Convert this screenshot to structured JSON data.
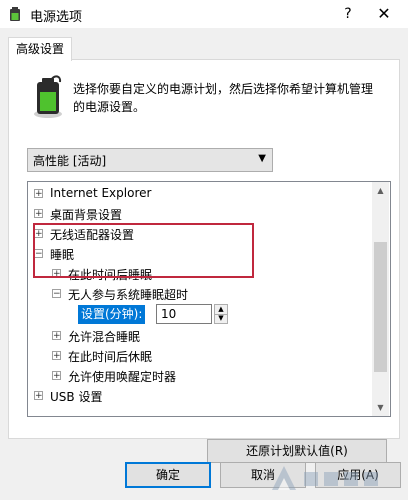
{
  "window": {
    "title": "电源选项",
    "help_glyph": "?",
    "close_glyph": "✕"
  },
  "tab": {
    "label": "高级设置"
  },
  "description": "选择你要自定义的电源计划，然后选择你希望计算机管理的电源设置。",
  "plan_select": {
    "value": "高性能 [活动]",
    "arrow": "▼"
  },
  "tree": {
    "items": [
      {
        "label": "Internet Explorer",
        "expander": "+"
      },
      {
        "label": "桌面背景设置",
        "expander": "+"
      },
      {
        "label": "无线适配器设置",
        "expander": "+"
      },
      {
        "label": "睡眠",
        "expander": "−"
      },
      {
        "label": "在此时间后睡眠",
        "expander": "+"
      },
      {
        "label": "无人参与系统睡眠超时",
        "expander": "−"
      },
      {
        "label": "允许混合睡眠",
        "expander": "+"
      },
      {
        "label": "在此时间后休眠",
        "expander": "+"
      },
      {
        "label": "允许使用唤醒定时器",
        "expander": "+"
      },
      {
        "label": "USB 设置",
        "expander": "+"
      }
    ],
    "setting": {
      "label": "设置(分钟):",
      "value": "10"
    },
    "scroll_up": "▲",
    "scroll_down": "▼"
  },
  "buttons": {
    "restore": "还原计划默认值(R)",
    "ok": "确定",
    "cancel": "取消",
    "apply": "应用(A)"
  },
  "colors": {
    "highlight_border": "#c0283e",
    "selection": "#0078d7"
  }
}
